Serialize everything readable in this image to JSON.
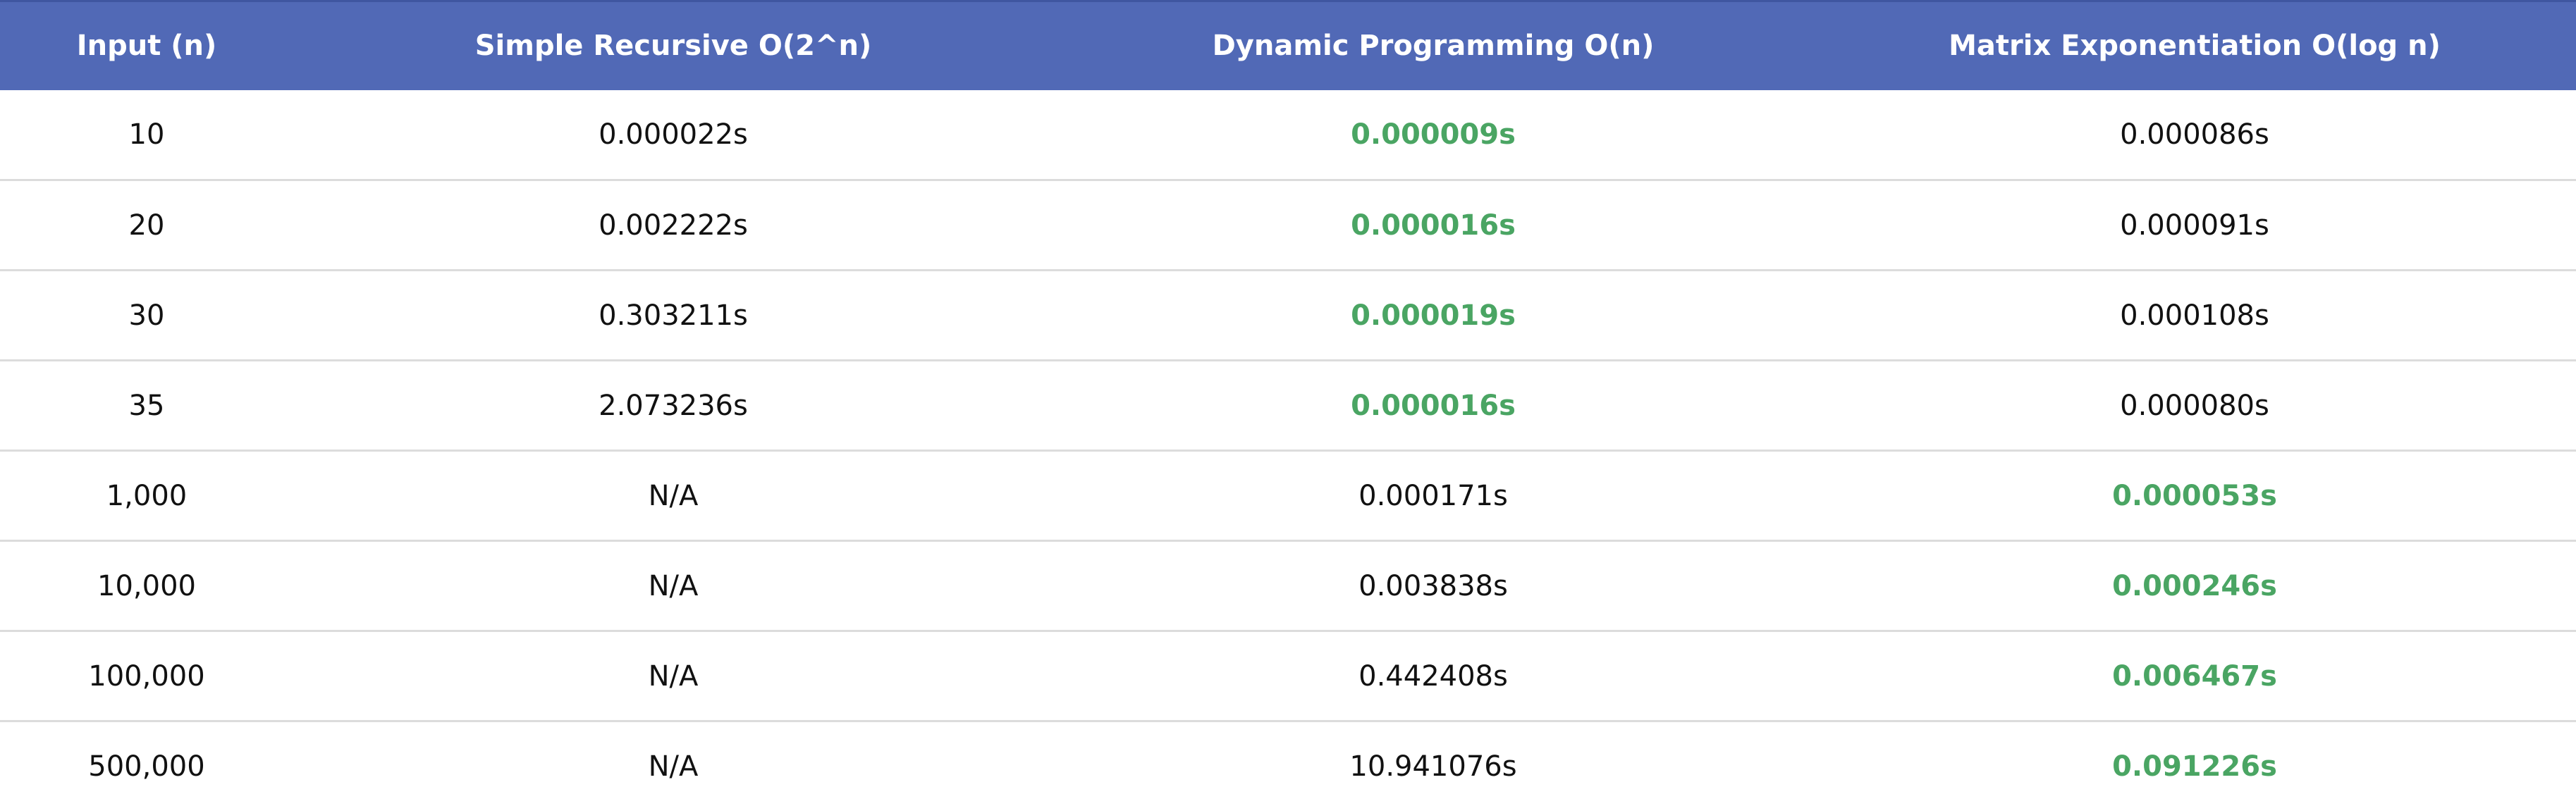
{
  "table": {
    "columns": [
      "Input (n)",
      "Simple Recursive O(2^n)",
      "Dynamic Programming O(n)",
      "Matrix Exponentiation O(log n)"
    ],
    "rows": [
      {
        "input": "10",
        "recursive": "0.000022s",
        "dp": "0.000009s",
        "matrix": "0.000086s"
      },
      {
        "input": "20",
        "recursive": "0.002222s",
        "dp": "0.000016s",
        "matrix": "0.000091s"
      },
      {
        "input": "30",
        "recursive": "0.303211s",
        "dp": "0.000019s",
        "matrix": "0.000108s"
      },
      {
        "input": "35",
        "recursive": "2.073236s",
        "dp": "0.000016s",
        "matrix": "0.000080s"
      },
      {
        "input": "1,000",
        "recursive": "N/A",
        "dp": "0.000171s",
        "matrix": "0.000053s"
      },
      {
        "input": "10,000",
        "recursive": "N/A",
        "dp": "0.003838s",
        "matrix": "0.000246s"
      },
      {
        "input": "100,000",
        "recursive": "N/A",
        "dp": "0.442408s",
        "matrix": "0.006467s"
      },
      {
        "input": "500,000",
        "recursive": "N/A",
        "dp": "10.941076s",
        "matrix": "0.091226s"
      }
    ]
  },
  "colors": {
    "header_background": "#5169b6",
    "header_text": "#ffffff",
    "fastest_highlight": "#4aa563",
    "row_divider": "#dcdcdc"
  }
}
